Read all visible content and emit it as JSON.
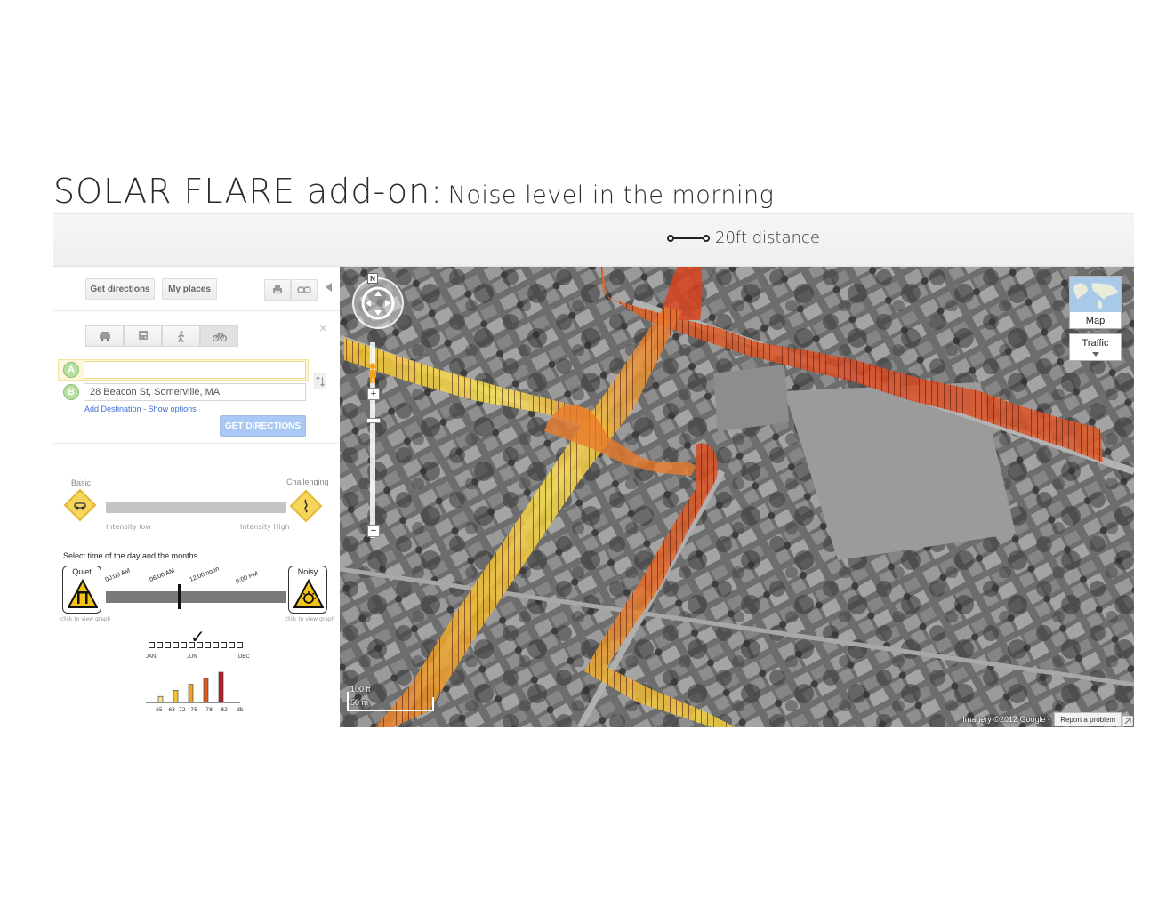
{
  "title": {
    "main": "SOLAR FLARE add-on:",
    "sub": "Noise level in the morning"
  },
  "distance_label": "20ft distance",
  "sidebar": {
    "get_directions_btn": "Get directions",
    "my_places_btn": "My places",
    "print_icon": "printer-icon",
    "link_icon": "link-icon",
    "collapse_icon": "triangle-left-icon",
    "close_glyph": "×",
    "travel_modes": [
      "car-icon",
      "transit-icon",
      "walk-icon",
      "bike-icon"
    ],
    "waypoint_a": {
      "marker": "A",
      "value": ""
    },
    "waypoint_b": {
      "marker": "B",
      "value": "28 Beacon St, Somerville, MA"
    },
    "add_destination": "Add Destination",
    "separator": "-",
    "show_options": "Show options",
    "get_directions_submit": "GET DIRECTIONS"
  },
  "intensity": {
    "basic_label": "Basic",
    "challenging_label": "Challenging",
    "low_label": "Intensity low",
    "high_label": "Intensity High"
  },
  "time_select": {
    "heading": "Select time of the day and the months",
    "quiet_label": "Quiet",
    "noisy_label": "Noisy",
    "quiet_caption": "click to view graph",
    "noisy_caption": "click to view graph",
    "ticks": [
      "00:00 AM",
      "06:00 AM",
      "12:00 noon",
      "6:00 PM"
    ],
    "selected_time_fraction": 0.4,
    "month_labels": [
      "JAN",
      "JUN",
      "DEC"
    ],
    "month_count": 12,
    "selected_month_index": 5,
    "check_glyph": "✓"
  },
  "noise_chart": {
    "categories": [
      "65-",
      "68- 72",
      "-75",
      "-78",
      "-82"
    ],
    "unit": "db",
    "values": [
      1,
      2,
      3,
      4,
      5
    ],
    "colors": [
      "#f7e39a",
      "#f2c42f",
      "#f0a020",
      "#e05a1e",
      "#b5202a"
    ]
  },
  "map": {
    "compass_label": "N",
    "zoom_in": "+",
    "zoom_out": "−",
    "map_type_btn": "Map",
    "traffic_btn": "Traffic",
    "scale_ft": "100 ft",
    "scale_m": "50 m",
    "imagery_credit": "Imagery ©2012 Google",
    "separator": "-",
    "report_problem": "Report a problem",
    "noise_colors": {
      "low": "#f7e65a",
      "mid": "#f0a020",
      "high": "#e5502a"
    }
  }
}
